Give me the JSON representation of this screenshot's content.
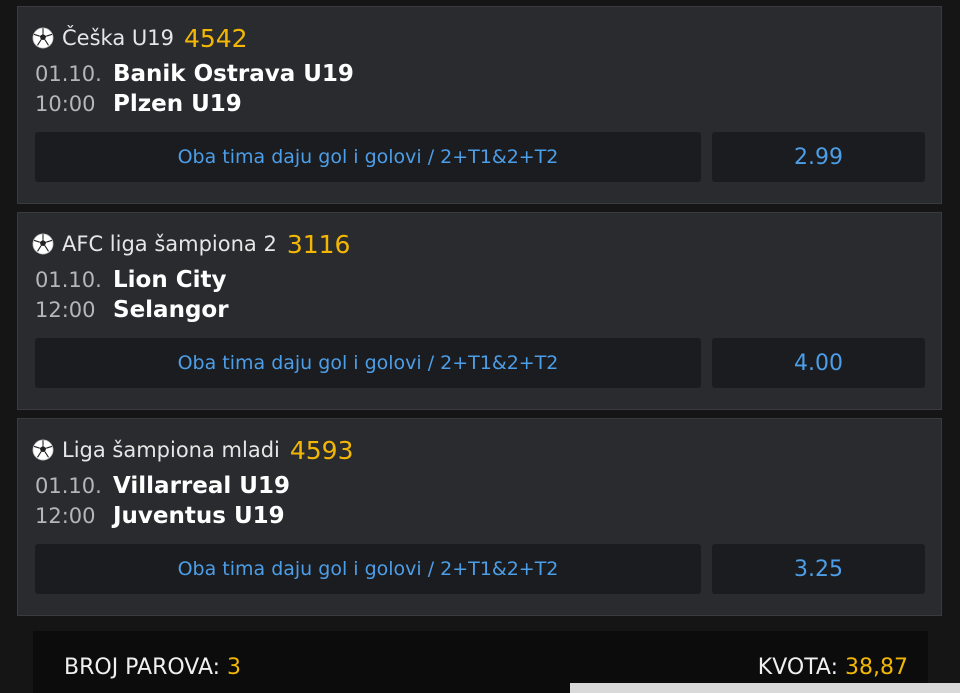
{
  "tickets": [
    {
      "league": "Češka U19",
      "code": "4542",
      "date": "01.10.",
      "time": "10:00",
      "home": "Banik Ostrava U19",
      "away": "Plzen U19",
      "pick": "Oba tima daju gol i golovi / 2+T1&2+T2",
      "odd": "2.99"
    },
    {
      "league": "AFC liga šampiona 2",
      "code": "3116",
      "date": "01.10.",
      "time": "12:00",
      "home": "Lion City",
      "away": "Selangor",
      "pick": "Oba tima daju gol i golovi / 2+T1&2+T2",
      "odd": "4.00"
    },
    {
      "league": "Liga šampiona mladi",
      "code": "4593",
      "date": "01.10.",
      "time": "12:00",
      "home": "Villarreal U19",
      "away": "Juventus U19",
      "pick": "Oba tima daju gol i golovi / 2+T1&2+T2",
      "odd": "3.25"
    }
  ],
  "summary": {
    "pairs_label": "BROJ PAROVA:",
    "pairs_value": "3",
    "odds_label": "KVOTA:",
    "odds_value": "38,87"
  },
  "icons": {
    "sport": "soccer-ball-icon"
  }
}
